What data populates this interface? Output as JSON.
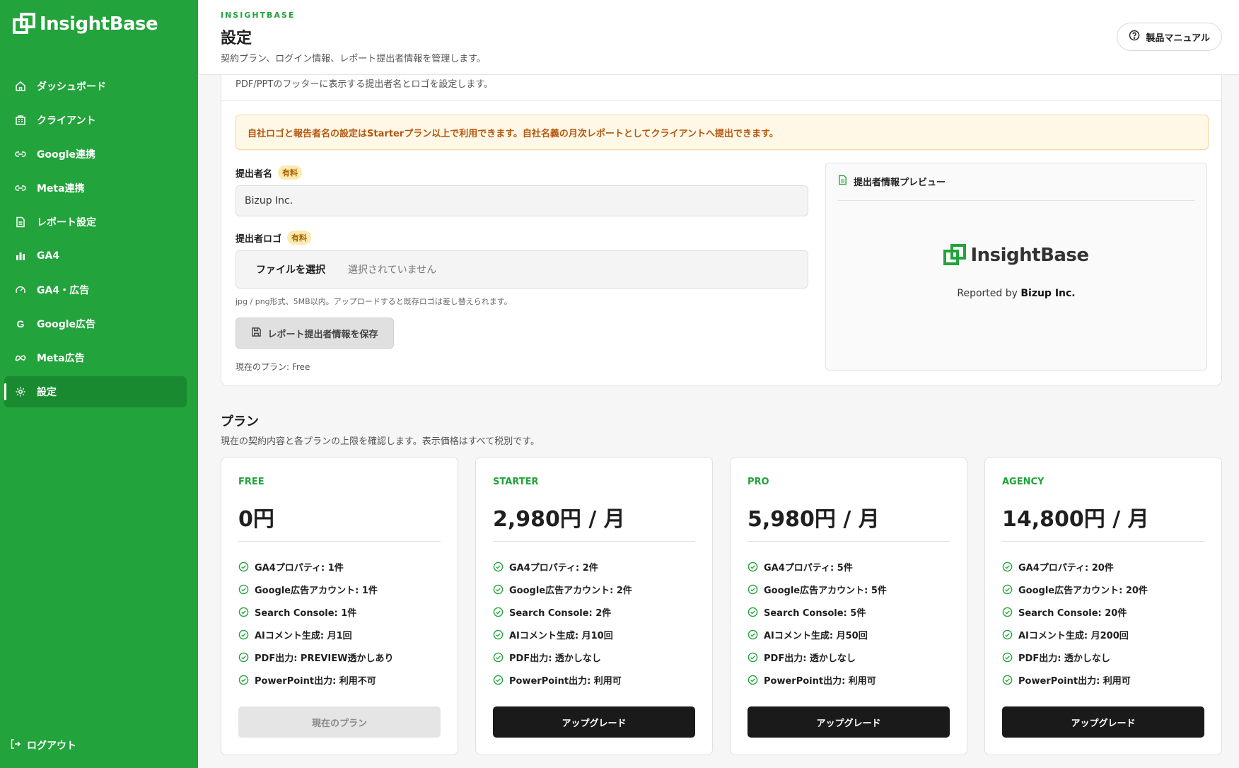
{
  "app": {
    "name": "InsightBase"
  },
  "sidebar": {
    "items": [
      {
        "label": "ダッシュボード",
        "icon": "home-icon"
      },
      {
        "label": "クライアント",
        "icon": "building-icon"
      },
      {
        "label": "Google連携",
        "icon": "link-icon"
      },
      {
        "label": "Meta連携",
        "icon": "link-icon"
      },
      {
        "label": "レポート設定",
        "icon": "document-icon"
      },
      {
        "label": "GA4",
        "icon": "bar-chart-icon"
      },
      {
        "label": "GA4・広告",
        "icon": "gauge-icon"
      },
      {
        "label": "Google広告",
        "icon": "google-icon"
      },
      {
        "label": "Meta広告",
        "icon": "meta-icon"
      },
      {
        "label": "設定",
        "icon": "gear-icon",
        "active": true
      }
    ],
    "logout": "ログアウト"
  },
  "header": {
    "brand": "INSIGHTBASE",
    "title": "設定",
    "description": "契約プラン、ログイン情報、レポート提出者情報を管理します。",
    "manual_button": "製品マニュアル"
  },
  "reporter": {
    "description": "PDF/PPTのフッターに表示する提出者名とロゴを設定します。",
    "notice": "自社ロゴと報告者名の設定はStarterプラン以上で利用できます。自社名義の月次レポートとしてクライアントへ提出できます。",
    "name_label": "提出者名",
    "paid_badge": "有料",
    "name_value": "Bizup Inc.",
    "logo_label": "提出者ロゴ",
    "file_button": "ファイルを選択",
    "file_status": "選択されていません",
    "file_help": "jpg / png形式、5MB以内。アップロードすると既存ロゴは差し替えられます。",
    "save_button": "レポート提出者情報を保存",
    "current_plan": "現在のプラン: Free",
    "preview_title": "提出者情報プレビュー",
    "preview_logo": "InsightBase",
    "reported_by": "Reported by",
    "reported_name": "Bizup Inc."
  },
  "plans": {
    "title": "プラン",
    "description": "現在の契約内容と各プランの上限を確認します。表示価格はすべて税別です。",
    "list": [
      {
        "name": "FREE",
        "price": "0円",
        "features": [
          "GA4プロパティ: 1件",
          "Google広告アカウント: 1件",
          "Search Console: 1件",
          "AIコメント生成: 月1回",
          "PDF出力: PREVIEW透かしあり",
          "PowerPoint出力: 利用不可"
        ],
        "button": "現在のプラン",
        "current": true
      },
      {
        "name": "STARTER",
        "price": "2,980円 / 月",
        "features": [
          "GA4プロパティ: 2件",
          "Google広告アカウント: 2件",
          "Search Console: 2件",
          "AIコメント生成: 月10回",
          "PDF出力: 透かしなし",
          "PowerPoint出力: 利用可"
        ],
        "button": "アップグレード",
        "current": false
      },
      {
        "name": "PRO",
        "price": "5,980円 / 月",
        "features": [
          "GA4プロパティ: 5件",
          "Google広告アカウント: 5件",
          "Search Console: 5件",
          "AIコメント生成: 月50回",
          "PDF出力: 透かしなし",
          "PowerPoint出力: 利用可"
        ],
        "button": "アップグレード",
        "current": false
      },
      {
        "name": "AGENCY",
        "price": "14,800円 / 月",
        "features": [
          "GA4プロパティ: 20件",
          "Google広告アカウント: 20件",
          "Search Console: 20件",
          "AIコメント生成: 月200回",
          "PDF出力: 透かしなし",
          "PowerPoint出力: 利用可"
        ],
        "button": "アップグレード",
        "current": false
      }
    ]
  },
  "colors": {
    "brand": "#22a33b",
    "sidebar_active": "#1a8a30",
    "notice_text": "#b5560f",
    "notice_bg": "#fff8e6"
  }
}
